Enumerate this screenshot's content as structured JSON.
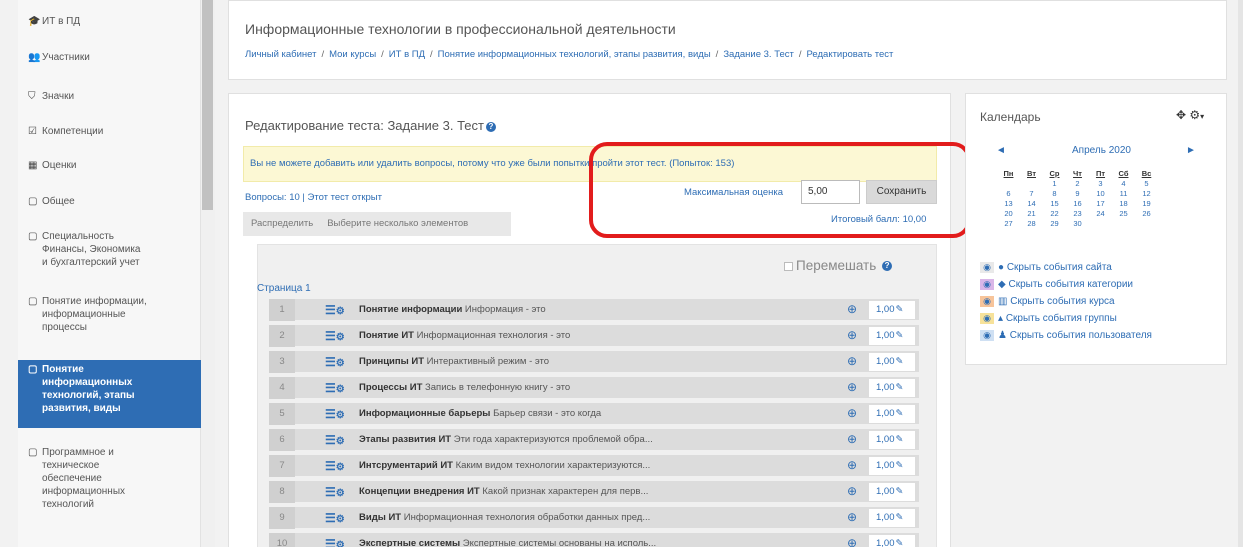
{
  "sidebar": {
    "items": [
      {
        "icon": "graduation-cap-icon",
        "glyph": "🎓",
        "label": "ИТ в ПД"
      },
      {
        "icon": "users-icon",
        "glyph": "👥",
        "label": "Участники"
      },
      {
        "icon": "shield-icon",
        "glyph": "⛉",
        "label": "Значки"
      },
      {
        "icon": "checkbox-icon",
        "glyph": "☑",
        "label": "Компетенции"
      },
      {
        "icon": "table-icon",
        "glyph": "▦",
        "label": "Оценки"
      },
      {
        "icon": "folder-icon",
        "glyph": "▢",
        "label": "Общее"
      },
      {
        "icon": "folder-icon",
        "glyph": "▢",
        "label": "Специальность",
        "lines": [
          "Финансы, Экономика",
          "и бухгалтерский учет"
        ]
      },
      {
        "icon": "folder-icon",
        "glyph": "▢",
        "label": "Понятие информации,",
        "lines": [
          "информационные",
          "процессы"
        ]
      },
      {
        "icon": "folder-icon",
        "glyph": "▢",
        "label": "Понятие",
        "lines": [
          "информационных",
          "технологий, этапы",
          "развития, виды"
        ],
        "active": true
      },
      {
        "icon": "folder-icon",
        "glyph": "▢",
        "label": "Программное и",
        "lines": [
          "техническое",
          "обеспечение",
          "информационных",
          "технологий"
        ]
      }
    ]
  },
  "header": {
    "title": "Информационные технологии в профессиональной деятельности",
    "breadcrumb": [
      "Личный кабинет",
      "Мои курсы",
      "ИТ в ПД",
      "Понятие информационных технологий, этапы развития, виды",
      "Задание 3. Тест",
      "Редактировать тест"
    ]
  },
  "main": {
    "title": "Редактирование теста: Задание 3. Тест",
    "warning": "Вы не можете добавить или удалить вопросы, потому что уже были попытки пройти этот тест. (Попыток: 153)",
    "questions_info": "Вопросы: 10 | Этот тест открыт",
    "max_grade_label": "Максимальная оценка",
    "max_grade_value": "5,00",
    "save_label": "Сохранить",
    "total_grade": "Итоговый балл: 10,00",
    "repaginate_label": "Распределить",
    "select_multiple_label": "Выберите несколько элементов",
    "shuffle_label": "Перемешать",
    "page_label": "Страница 1"
  },
  "questions": [
    {
      "num": "1",
      "name": "Понятие информации",
      "text": "Информация - это",
      "mark": "1,00"
    },
    {
      "num": "2",
      "name": "Понятие ИТ",
      "text": "Информационная технология - это",
      "mark": "1,00"
    },
    {
      "num": "3",
      "name": "Принципы ИТ",
      "text": "Интерактивный режим - это",
      "mark": "1,00"
    },
    {
      "num": "4",
      "name": "Процессы ИТ",
      "text": "Запись в телефонную книгу - это",
      "mark": "1,00"
    },
    {
      "num": "5",
      "name": "Информационные барьеры",
      "text": "Барьер связи - это когда",
      "mark": "1,00"
    },
    {
      "num": "6",
      "name": "Этапы развития ИТ",
      "text": "Эти года характеризуются проблемой обра...",
      "mark": "1,00"
    },
    {
      "num": "7",
      "name": "Интсрументарий ИТ",
      "text": "Каким видом технологии характеризуются...",
      "mark": "1,00"
    },
    {
      "num": "8",
      "name": "Концепции внедрения ИТ",
      "text": "Какой признак характерен для  перв...",
      "mark": "1,00"
    },
    {
      "num": "9",
      "name": "Виды ИТ",
      "text": "Информационная технология обработки данных пред...",
      "mark": "1,00"
    },
    {
      "num": "10",
      "name": "Экспертные системы",
      "text": "Экспертные системы основаны на исполь...",
      "mark": "1,00"
    }
  ],
  "calendar": {
    "title": "Календарь",
    "month": "Апрель 2020",
    "prev": "◄",
    "next": "►",
    "weekdays": [
      "Пн",
      "Вт",
      "Ср",
      "Чт",
      "Пт",
      "Сб",
      "Вс"
    ],
    "weeks": [
      [
        "",
        "",
        "1",
        "2",
        "3",
        "4",
        "5"
      ],
      [
        "6",
        "7",
        "8",
        "9",
        "10",
        "11",
        "12"
      ],
      [
        "13",
        "14",
        "15",
        "16",
        "17",
        "18",
        "19"
      ],
      [
        "20",
        "21",
        "22",
        "23",
        "24",
        "25",
        "26"
      ],
      [
        "27",
        "28",
        "29",
        "30",
        "",
        "",
        ""
      ]
    ],
    "filters": [
      {
        "label": "Скрыть события сайта",
        "color": "#e9e9e9",
        "icon": "globe-icon",
        "glyph": "●"
      },
      {
        "label": "Скрыть события категории",
        "color": "#d9b6e8",
        "icon": "cubes-icon",
        "glyph": "◆"
      },
      {
        "label": "Скрыть события курса",
        "color": "#f7c49a",
        "icon": "university-icon",
        "glyph": "▥"
      },
      {
        "label": "Скрыть события группы",
        "color": "#f7e29a",
        "icon": "users-icon",
        "glyph": "▴"
      },
      {
        "label": "Скрыть события пользователя",
        "color": "#cfe0f3",
        "icon": "user-icon",
        "glyph": "♟"
      }
    ]
  },
  "colors": {
    "accent": "#2e6db4",
    "highlight": "#e21c1c",
    "warning_bg": "#fcf8d4"
  }
}
